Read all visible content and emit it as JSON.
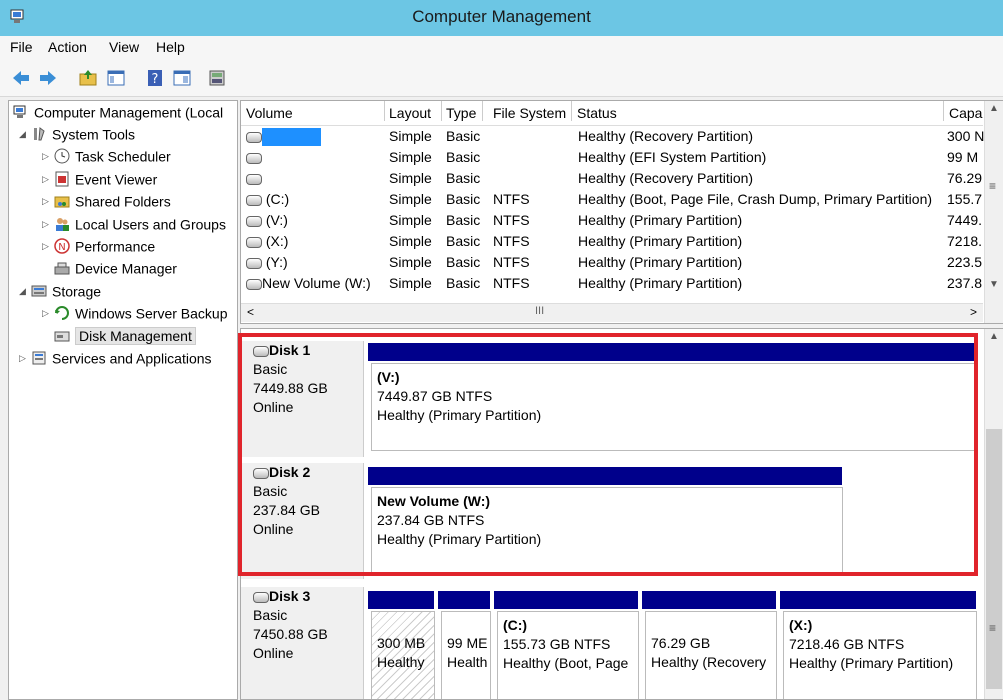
{
  "window": {
    "title": "Computer Management"
  },
  "menu": [
    "File",
    "Action",
    "View",
    "Help"
  ],
  "tree": {
    "root": "Computer Management (Local",
    "system_tools": "System Tools",
    "task_scheduler": "Task Scheduler",
    "event_viewer": "Event Viewer",
    "shared_folders": "Shared Folders",
    "local_users": "Local Users and Groups",
    "performance": "Performance",
    "device_manager": "Device Manager",
    "storage": "Storage",
    "wsb": "Windows Server Backup",
    "disk_management": "Disk Management",
    "services": "Services and Applications"
  },
  "volumes": {
    "headers": {
      "volume": "Volume",
      "layout": "Layout",
      "type": "Type",
      "fs": "File System",
      "status": "Status",
      "capacity": "Capa"
    },
    "rows": [
      {
        "volume": "",
        "layout": "Simple",
        "type": "Basic",
        "fs": "",
        "status": "Healthy (Recovery Partition)",
        "capacity": "300 N"
      },
      {
        "volume": "",
        "layout": "Simple",
        "type": "Basic",
        "fs": "",
        "status": "Healthy (EFI System Partition)",
        "capacity": "99 M"
      },
      {
        "volume": "",
        "layout": "Simple",
        "type": "Basic",
        "fs": "",
        "status": "Healthy (Recovery Partition)",
        "capacity": "76.29"
      },
      {
        "volume": "(C:)",
        "layout": "Simple",
        "type": "Basic",
        "fs": "NTFS",
        "status": "Healthy (Boot, Page File, Crash Dump, Primary Partition)",
        "capacity": "155.7"
      },
      {
        "volume": "(V:)",
        "layout": "Simple",
        "type": "Basic",
        "fs": "NTFS",
        "status": "Healthy (Primary Partition)",
        "capacity": "7449."
      },
      {
        "volume": "(X:)",
        "layout": "Simple",
        "type": "Basic",
        "fs": "NTFS",
        "status": "Healthy (Primary Partition)",
        "capacity": "7218."
      },
      {
        "volume": "(Y:)",
        "layout": "Simple",
        "type": "Basic",
        "fs": "NTFS",
        "status": "Healthy (Primary Partition)",
        "capacity": "223.5"
      },
      {
        "volume": "New Volume (W:)",
        "layout": "Simple",
        "type": "Basic",
        "fs": "NTFS",
        "status": "Healthy (Primary Partition)",
        "capacity": "237.8"
      }
    ],
    "hscroll_label": "III"
  },
  "disks": {
    "disk1": {
      "name": "Disk 1",
      "type": "Basic",
      "size": "7449.88 GB",
      "state": "Online",
      "p1": {
        "title": "(V:)",
        "size": "7449.87 GB NTFS",
        "status": "Healthy (Primary Partition)"
      }
    },
    "disk2": {
      "name": "Disk 2",
      "type": "Basic",
      "size": "237.84 GB",
      "state": "Online",
      "p1": {
        "title": "New Volume  (W:)",
        "size": "237.84 GB NTFS",
        "status": "Healthy (Primary Partition)"
      }
    },
    "disk3": {
      "name": "Disk 3",
      "type": "Basic",
      "size": "7450.88 GB",
      "state": "Online",
      "p1": {
        "size": "300 MB",
        "status": "Healthy"
      },
      "p2": {
        "size": "99 ME",
        "status": "Health"
      },
      "p3": {
        "title": "(C:)",
        "size": "155.73 GB NTFS",
        "status": "Healthy (Boot, Page"
      },
      "p4": {
        "size": "76.29 GB",
        "status": "Healthy (Recovery"
      },
      "p5": {
        "title": "(X:)",
        "size": "7218.46 GB NTFS",
        "status": "Healthy (Primary Partition)"
      }
    }
  },
  "colors": {
    "titlebar": "#6cc6e4",
    "partition_header": "#00008b",
    "highlight": "#e0242b",
    "selected_volume": "#1e90ff"
  }
}
